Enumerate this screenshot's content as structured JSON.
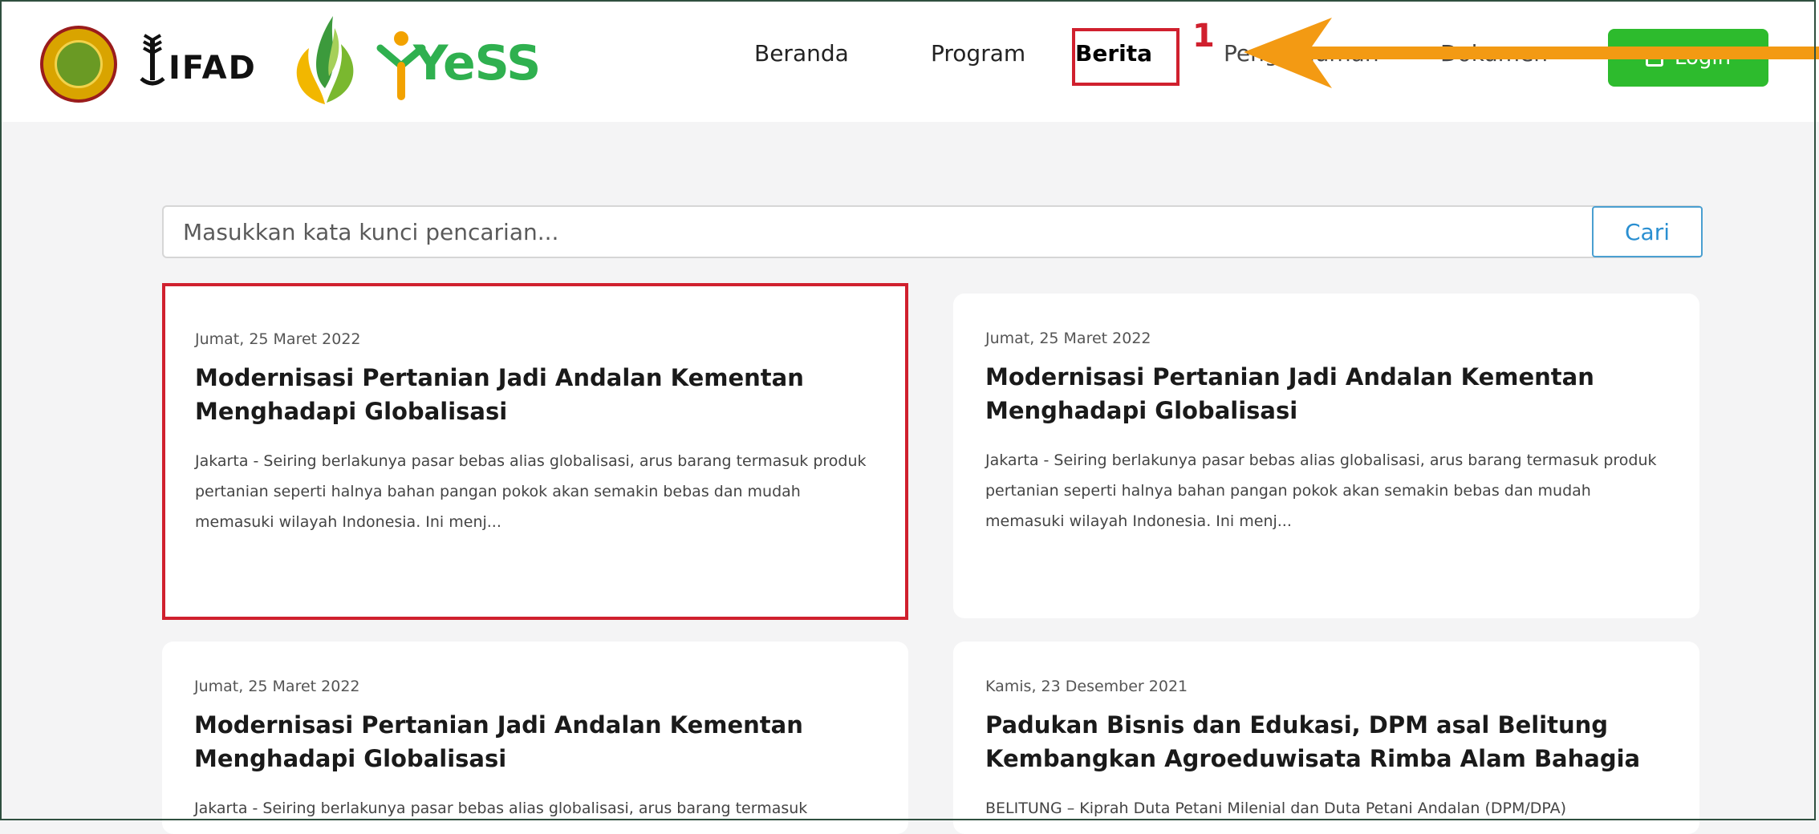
{
  "header": {
    "logos": {
      "ifad": "IFAD",
      "yess": "YeSS"
    },
    "nav": {
      "beranda": "Beranda",
      "program": "Program",
      "berita": "Berita",
      "pengumuman": "Pengumuman",
      "dokumen": "Dokumen"
    },
    "login_label": "Login",
    "step_number": "1"
  },
  "search": {
    "placeholder": "Masukkan kata kunci pencarian...",
    "button_label": "Cari"
  },
  "articles": [
    {
      "date": "Jumat, 25 Maret 2022",
      "title": "Modernisasi Pertanian Jadi Andalan Kementan Menghadapi Globalisasi",
      "excerpt": "Jakarta - Seiring berlakunya pasar bebas alias globalisasi, arus barang termasuk produk pertanian seperti halnya bahan pangan pokok akan semakin bebas dan mudah memasuki wilayah Indonesia. Ini menj..."
    },
    {
      "date": "Jumat, 25 Maret 2022",
      "title": "Modernisasi Pertanian Jadi Andalan Kementan Menghadapi Globalisasi",
      "excerpt": "Jakarta - Seiring berlakunya pasar bebas alias globalisasi, arus barang termasuk produk pertanian seperti halnya bahan pangan pokok akan semakin bebas dan mudah memasuki wilayah Indonesia. Ini menj..."
    },
    {
      "date": "Jumat, 25 Maret 2022",
      "title": "Modernisasi Pertanian Jadi Andalan Kementan Menghadapi Globalisasi",
      "excerpt": "Jakarta - Seiring berlakunya pasar bebas alias globalisasi, arus barang termasuk"
    },
    {
      "date": "Kamis, 23 Desember 2021",
      "title": "Padukan Bisnis dan Edukasi, DPM asal Belitung Kembangkan Agroeduwisata Rimba Alam Bahagia",
      "excerpt": "BELITUNG – Kiprah Duta Petani Milenial dan Duta Petani Andalan (DPM/DPA)"
    }
  ],
  "colors": {
    "accent_green": "#2dbb2d",
    "highlight_red": "#d0202e",
    "arrow_orange": "#f39a13",
    "search_blue": "#4a9fd1"
  }
}
